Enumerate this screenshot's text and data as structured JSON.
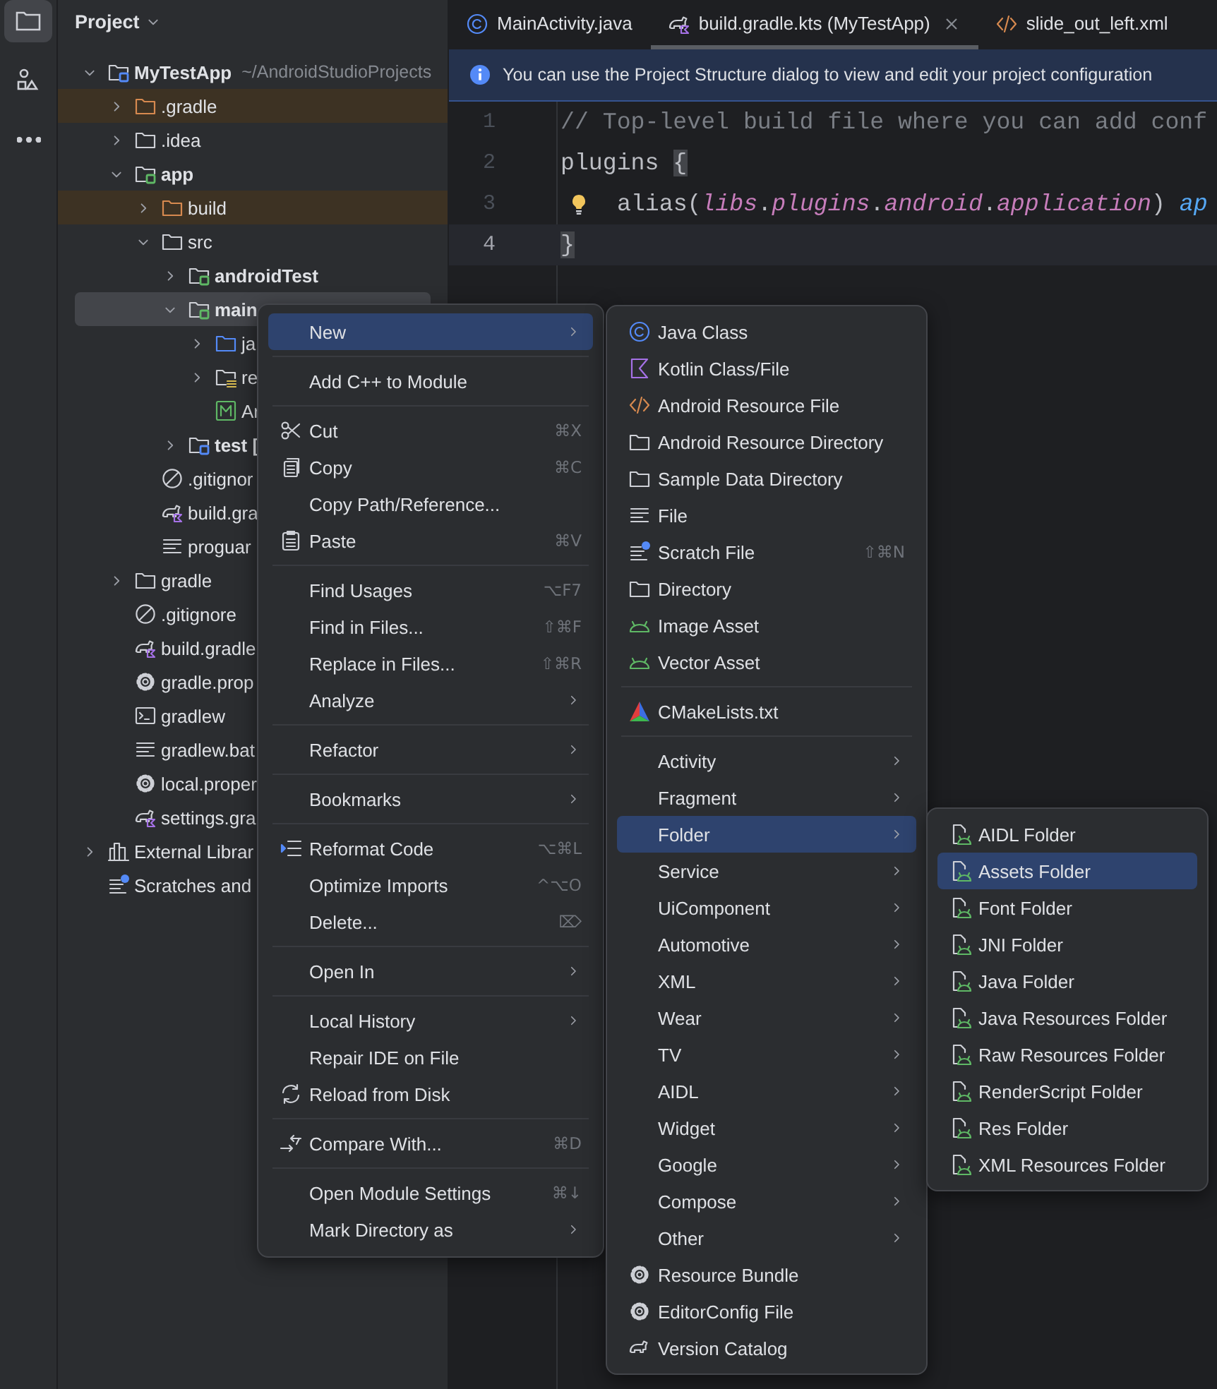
{
  "tool_strip": [
    {
      "kind": "project",
      "selected": true
    },
    {
      "kind": "structure",
      "selected": false
    },
    {
      "kind": "more",
      "selected": false
    }
  ],
  "project_panel": {
    "title": "Project",
    "tree": [
      {
        "label": "MyTestApp",
        "hint": "~/AndroidStudioProjects",
        "kind": "module",
        "color": "#548af7",
        "expanded": true,
        "selected": false,
        "children": [
          {
            "label": ".gradle",
            "kind": "folder",
            "expanded": false,
            "excluded": true,
            "selected": false
          },
          {
            "label": ".idea",
            "kind": "folder",
            "expanded": false,
            "excluded": false,
            "selected": false
          },
          {
            "label": "app",
            "kind": "module",
            "color": "#5fb865",
            "expanded": true,
            "selected": false,
            "children": [
              {
                "label": "build",
                "kind": "folder",
                "expanded": false,
                "excluded": true,
                "selected": false
              },
              {
                "label": "src",
                "kind": "folder",
                "expanded": true,
                "excluded": false,
                "selected": false,
                "children": [
                  {
                    "label": "androidTest",
                    "kind": "module",
                    "color": "#5fb865",
                    "expanded": false,
                    "selected": false
                  },
                  {
                    "label": "main",
                    "kind": "module",
                    "color": "#5fb865",
                    "expanded": true,
                    "selected": true,
                    "children": [
                      {
                        "label": "ja",
                        "kind": "source-folder",
                        "expanded": false,
                        "selected": false
                      },
                      {
                        "label": "re",
                        "kind": "res-folder",
                        "expanded": false,
                        "selected": false
                      },
                      {
                        "label": "Ar",
                        "kind": "manifest",
                        "selected": false
                      }
                    ]
                  },
                  {
                    "label": "test [",
                    "kind": "module",
                    "color": "#548af7",
                    "expanded": false,
                    "selected": false
                  }
                ]
              },
              {
                "label": ".gitignor",
                "kind": "ignore",
                "selected": false
              },
              {
                "label": "build.gra",
                "kind": "gradle-script",
                "selected": false
              },
              {
                "label": "proguar",
                "kind": "text-file",
                "selected": false
              }
            ]
          },
          {
            "label": "gradle",
            "kind": "folder",
            "expanded": false,
            "excluded": false,
            "selected": false
          },
          {
            "label": ".gitignore",
            "kind": "ignore",
            "selected": false
          },
          {
            "label": "build.gradle",
            "kind": "gradle-script",
            "selected": false
          },
          {
            "label": "gradle.prop",
            "kind": "properties",
            "selected": false
          },
          {
            "label": "gradlew",
            "kind": "terminal",
            "selected": false
          },
          {
            "label": "gradlew.bat",
            "kind": "text-file",
            "selected": false
          },
          {
            "label": "local.proper",
            "kind": "properties",
            "selected": false
          },
          {
            "label": "settings.gra",
            "kind": "gradle-script",
            "selected": false
          }
        ]
      },
      {
        "label": "External Librar",
        "kind": "libraries",
        "expanded": false,
        "selected": false
      },
      {
        "label": "Scratches and",
        "kind": "scratches",
        "selected": false
      }
    ]
  },
  "editor": {
    "tabs": [
      {
        "label": "MainActivity.java",
        "kind": "java",
        "selected": false
      },
      {
        "label": "build.gradle.kts (MyTestApp)",
        "kind": "gradle",
        "selected": true
      },
      {
        "label": "slide_out_left.xml",
        "kind": "xml",
        "selected": false
      }
    ],
    "banner": {
      "text": "You can use the Project Structure dialog to view and edit your project configuration"
    },
    "lines": [
      {
        "number": "1",
        "current": false,
        "intention": false,
        "tokens": [
          {
            "text": "// Top-level build file where you can add conf",
            "kind": "comment"
          }
        ]
      },
      {
        "number": "2",
        "current": false,
        "intention": false,
        "tokens": [
          {
            "text": "plugins ",
            "kind": "plain"
          },
          {
            "text": "{",
            "kind": "brace-match"
          }
        ]
      },
      {
        "number": "3",
        "current": false,
        "intention": true,
        "tokens": [
          {
            "text": "alias(",
            "kind": "plain"
          },
          {
            "text": "libs",
            "kind": "member"
          },
          {
            "text": ".",
            "kind": "plain"
          },
          {
            "text": "plugins",
            "kind": "member"
          },
          {
            "text": ".",
            "kind": "plain"
          },
          {
            "text": "android",
            "kind": "member"
          },
          {
            "text": ".",
            "kind": "plain"
          },
          {
            "text": "application",
            "kind": "member"
          },
          {
            "text": ") ",
            "kind": "plain"
          },
          {
            "text": "ap",
            "kind": "call"
          }
        ]
      },
      {
        "number": "4",
        "current": true,
        "intention": false,
        "tokens": [
          {
            "text": "}",
            "kind": "brace-match"
          }
        ]
      }
    ]
  },
  "context_menu": {
    "items": [
      {
        "kind": "plain",
        "label": "New",
        "submenu": true,
        "selected": true
      },
      {
        "kind": "separator"
      },
      {
        "kind": "plain",
        "label": "Add C++ to Module",
        "selected": false
      },
      {
        "kind": "separator"
      },
      {
        "kind": "cut",
        "label": "Cut",
        "shortcut": "⌘X",
        "selected": false
      },
      {
        "kind": "copy",
        "label": "Copy",
        "shortcut": "⌘C",
        "selected": false
      },
      {
        "kind": "plain",
        "label": "Copy Path/Reference...",
        "selected": false
      },
      {
        "kind": "paste",
        "label": "Paste",
        "shortcut": "⌘V",
        "selected": false
      },
      {
        "kind": "separator"
      },
      {
        "kind": "plain",
        "label": "Find Usages",
        "shortcut": "⌥F7",
        "selected": false
      },
      {
        "kind": "plain",
        "label": "Find in Files...",
        "shortcut": "⇧⌘F",
        "selected": false
      },
      {
        "kind": "plain",
        "label": "Replace in Files...",
        "shortcut": "⇧⌘R",
        "selected": false
      },
      {
        "kind": "plain",
        "label": "Analyze",
        "submenu": true,
        "selected": false
      },
      {
        "kind": "separator"
      },
      {
        "kind": "plain",
        "label": "Refactor",
        "submenu": true,
        "selected": false
      },
      {
        "kind": "separator"
      },
      {
        "kind": "plain",
        "label": "Bookmarks",
        "submenu": true,
        "selected": false
      },
      {
        "kind": "separator"
      },
      {
        "kind": "reformat",
        "label": "Reformat Code",
        "shortcut": "⌥⌘L",
        "selected": false
      },
      {
        "kind": "plain",
        "label": "Optimize Imports",
        "shortcut": "^⌥O",
        "selected": false
      },
      {
        "kind": "plain",
        "label": "Delete...",
        "shortcut": "⌦",
        "selected": false
      },
      {
        "kind": "separator"
      },
      {
        "kind": "plain",
        "label": "Open In",
        "submenu": true,
        "selected": false
      },
      {
        "kind": "separator"
      },
      {
        "kind": "plain",
        "label": "Local History",
        "submenu": true,
        "selected": false
      },
      {
        "kind": "plain",
        "label": "Repair IDE on File",
        "selected": false
      },
      {
        "kind": "reload",
        "label": "Reload from Disk",
        "selected": false
      },
      {
        "kind": "separator"
      },
      {
        "kind": "compare",
        "label": "Compare With...",
        "shortcut": "⌘D",
        "selected": false
      },
      {
        "kind": "separator"
      },
      {
        "kind": "plain",
        "label": "Open Module Settings",
        "shortcut": "⌘↓",
        "selected": false
      },
      {
        "kind": "plain",
        "label": "Mark Directory as",
        "submenu": true,
        "selected": false
      }
    ]
  },
  "new_submenu": {
    "items": [
      {
        "kind": "java-class",
        "label": "Java Class",
        "selected": false
      },
      {
        "kind": "kotlin",
        "label": "Kotlin Class/File",
        "selected": false
      },
      {
        "kind": "xml",
        "label": "Android Resource File",
        "selected": false
      },
      {
        "kind": "folder",
        "label": "Android Resource Directory",
        "selected": false
      },
      {
        "kind": "folder",
        "label": "Sample Data Directory",
        "selected": false
      },
      {
        "kind": "file",
        "label": "File",
        "selected": false
      },
      {
        "kind": "scratch",
        "label": "Scratch File",
        "shortcut": "⇧⌘N",
        "selected": false
      },
      {
        "kind": "folder",
        "label": "Directory",
        "selected": false
      },
      {
        "kind": "android",
        "label": "Image Asset",
        "selected": false
      },
      {
        "kind": "android",
        "label": "Vector Asset",
        "selected": false
      },
      {
        "kind": "separator"
      },
      {
        "kind": "cmake",
        "label": "CMakeLists.txt",
        "selected": false
      },
      {
        "kind": "separator"
      },
      {
        "kind": "plain",
        "label": "Activity",
        "submenu": true,
        "selected": false
      },
      {
        "kind": "plain",
        "label": "Fragment",
        "submenu": true,
        "selected": false
      },
      {
        "kind": "plain",
        "label": "Folder",
        "submenu": true,
        "selected": true
      },
      {
        "kind": "plain",
        "label": "Service",
        "submenu": true,
        "selected": false
      },
      {
        "kind": "plain",
        "label": "UiComponent",
        "submenu": true,
        "selected": false
      },
      {
        "kind": "plain",
        "label": "Automotive",
        "submenu": true,
        "selected": false
      },
      {
        "kind": "plain",
        "label": "XML",
        "submenu": true,
        "selected": false
      },
      {
        "kind": "plain",
        "label": "Wear",
        "submenu": true,
        "selected": false
      },
      {
        "kind": "plain",
        "label": "TV",
        "submenu": true,
        "selected": false
      },
      {
        "kind": "plain",
        "label": "AIDL",
        "submenu": true,
        "selected": false
      },
      {
        "kind": "plain",
        "label": "Widget",
        "submenu": true,
        "selected": false
      },
      {
        "kind": "plain",
        "label": "Google",
        "submenu": true,
        "selected": false
      },
      {
        "kind": "plain",
        "label": "Compose",
        "submenu": true,
        "selected": false
      },
      {
        "kind": "plain",
        "label": "Other",
        "submenu": true,
        "selected": false
      },
      {
        "kind": "gear",
        "label": "Resource Bundle",
        "selected": false
      },
      {
        "kind": "gear",
        "label": "EditorConfig File",
        "selected": false
      },
      {
        "kind": "catalog",
        "label": "Version Catalog",
        "selected": false
      }
    ]
  },
  "folder_submenu": {
    "items": [
      {
        "kind": "android-folder",
        "label": "AIDL Folder",
        "selected": false
      },
      {
        "kind": "android-folder",
        "label": "Assets Folder",
        "selected": true
      },
      {
        "kind": "android-folder",
        "label": "Font Folder",
        "selected": false
      },
      {
        "kind": "android-folder",
        "label": "JNI Folder",
        "selected": false
      },
      {
        "kind": "android-folder",
        "label": "Java Folder",
        "selected": false
      },
      {
        "kind": "android-folder",
        "label": "Java Resources Folder",
        "selected": false
      },
      {
        "kind": "android-folder",
        "label": "Raw Resources Folder",
        "selected": false
      },
      {
        "kind": "android-folder",
        "label": "RenderScript Folder",
        "selected": false
      },
      {
        "kind": "android-folder",
        "label": "Res Folder",
        "selected": false
      },
      {
        "kind": "android-folder",
        "label": "XML Resources Folder",
        "selected": false
      }
    ]
  }
}
